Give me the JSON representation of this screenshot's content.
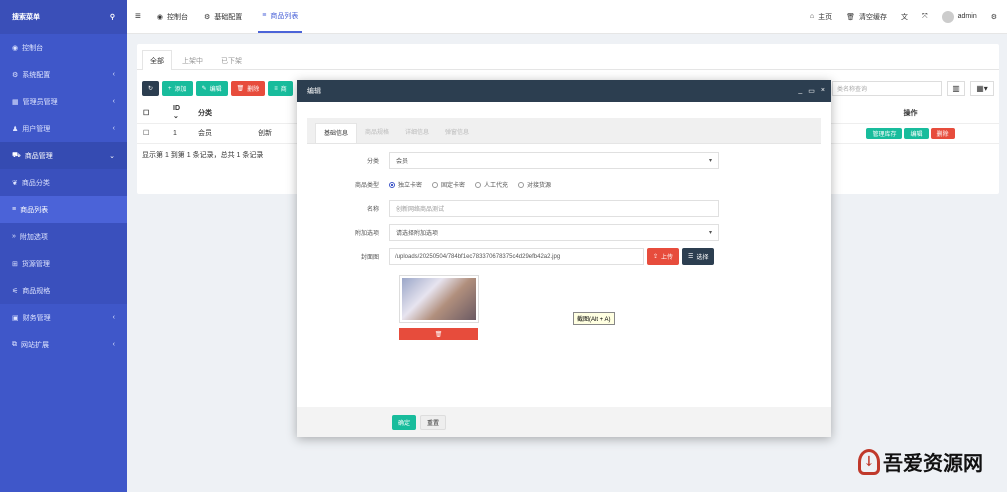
{
  "sidebar": {
    "search_label": "搜索菜单",
    "items": [
      {
        "label": "控制台",
        "icon": "dashboard-icon"
      },
      {
        "label": "系统配置",
        "icon": "cogs-icon"
      },
      {
        "label": "管理员管理",
        "icon": "users-icon"
      },
      {
        "label": "用户管理",
        "icon": "user-icon"
      },
      {
        "label": "商品管理",
        "icon": "cart-icon"
      },
      {
        "label": "商品分类",
        "icon": "leaf-icon"
      },
      {
        "label": "商品列表",
        "icon": "list-icon"
      },
      {
        "label": "附加选项",
        "icon": "angle-double-icon"
      },
      {
        "label": "货源管理",
        "icon": "sitemap-icon"
      },
      {
        "label": "商品规格",
        "icon": "sliders-icon"
      },
      {
        "label": "财务管理",
        "icon": "money-icon"
      },
      {
        "label": "网站扩展",
        "icon": "external-icon"
      }
    ]
  },
  "topbar": {
    "menu_icon": "bars-icon",
    "tabs": [
      "控制台",
      "基础配置",
      "商品列表"
    ],
    "home": "主页",
    "clear_cache": "清空缓存",
    "user": "admin"
  },
  "list": {
    "tabs": [
      "全部",
      "上架中",
      "已下架"
    ],
    "buttons": {
      "refresh": "",
      "add": "添加",
      "edit": "编辑",
      "delete": "删除",
      "more": "商"
    },
    "search_placeholder": "类名称查询",
    "headers": [
      "",
      "ID",
      "分类",
      "",
      "",
      "操作"
    ],
    "row": {
      "id": "1",
      "category": "会员",
      "name": "创新",
      "actions": [
        "管理库存",
        "编辑",
        "删除"
      ]
    },
    "footer": "显示第 1 到第 1 条记录，总共 1 条记录"
  },
  "modal": {
    "title": "编辑",
    "tabs": [
      "基础信息",
      "商品规格",
      "详细信息",
      "弹窗信息"
    ],
    "fields": {
      "category_label": "分类",
      "category_value": "会员",
      "type_label": "商品类型",
      "type_options": [
        "独立卡密",
        "固定卡密",
        "人工代充",
        "对接货源"
      ],
      "name_label": "名称",
      "name_value": "创新网络商品测试",
      "addon_label": "附加选项",
      "addon_value": "请选择附加选项",
      "cover_label": "封面图",
      "cover_value": "/uploads/20250504/784bf1ec783370678375c4d29efb42a2.jpg",
      "upload": "上传",
      "choose": "选择"
    },
    "confirm": "确定",
    "reset": "重置"
  },
  "tooltip": "截图(Alt + A)",
  "watermark": "吾爱资源网"
}
